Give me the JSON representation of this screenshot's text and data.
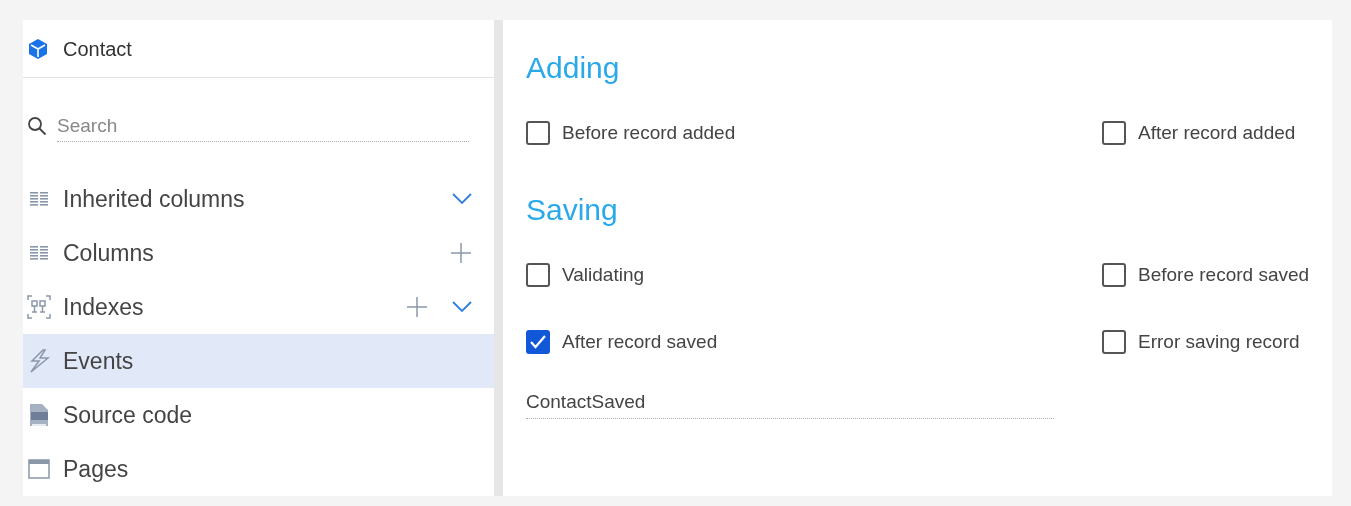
{
  "sidebar": {
    "title": "Contact",
    "search": {
      "placeholder": "Search"
    },
    "items": [
      {
        "label": "Inherited columns",
        "kind": "columns",
        "can_add": false,
        "expandable": true,
        "selected": false
      },
      {
        "label": "Columns",
        "kind": "columns",
        "can_add": true,
        "expandable": false,
        "selected": false
      },
      {
        "label": "Indexes",
        "kind": "indexes",
        "can_add": true,
        "expandable": true,
        "selected": false
      },
      {
        "label": "Events",
        "kind": "events",
        "can_add": false,
        "expandable": false,
        "selected": true
      },
      {
        "label": "Source code",
        "kind": "code",
        "can_add": false,
        "expandable": false,
        "selected": false
      },
      {
        "label": "Pages",
        "kind": "pages",
        "can_add": false,
        "expandable": false,
        "selected": false
      }
    ]
  },
  "sections": [
    {
      "title": "Adding",
      "checkboxes": [
        {
          "label": "Before record added",
          "checked": false
        },
        {
          "label": "After record added",
          "checked": false
        }
      ]
    },
    {
      "title": "Saving",
      "checkboxes": [
        {
          "label": "Validating",
          "checked": false
        },
        {
          "label": "Before record saved",
          "checked": false
        },
        {
          "label": "After record saved",
          "checked": true
        },
        {
          "label": "Error saving record",
          "checked": false
        }
      ],
      "field": {
        "value": "ContactSaved"
      }
    }
  ]
}
